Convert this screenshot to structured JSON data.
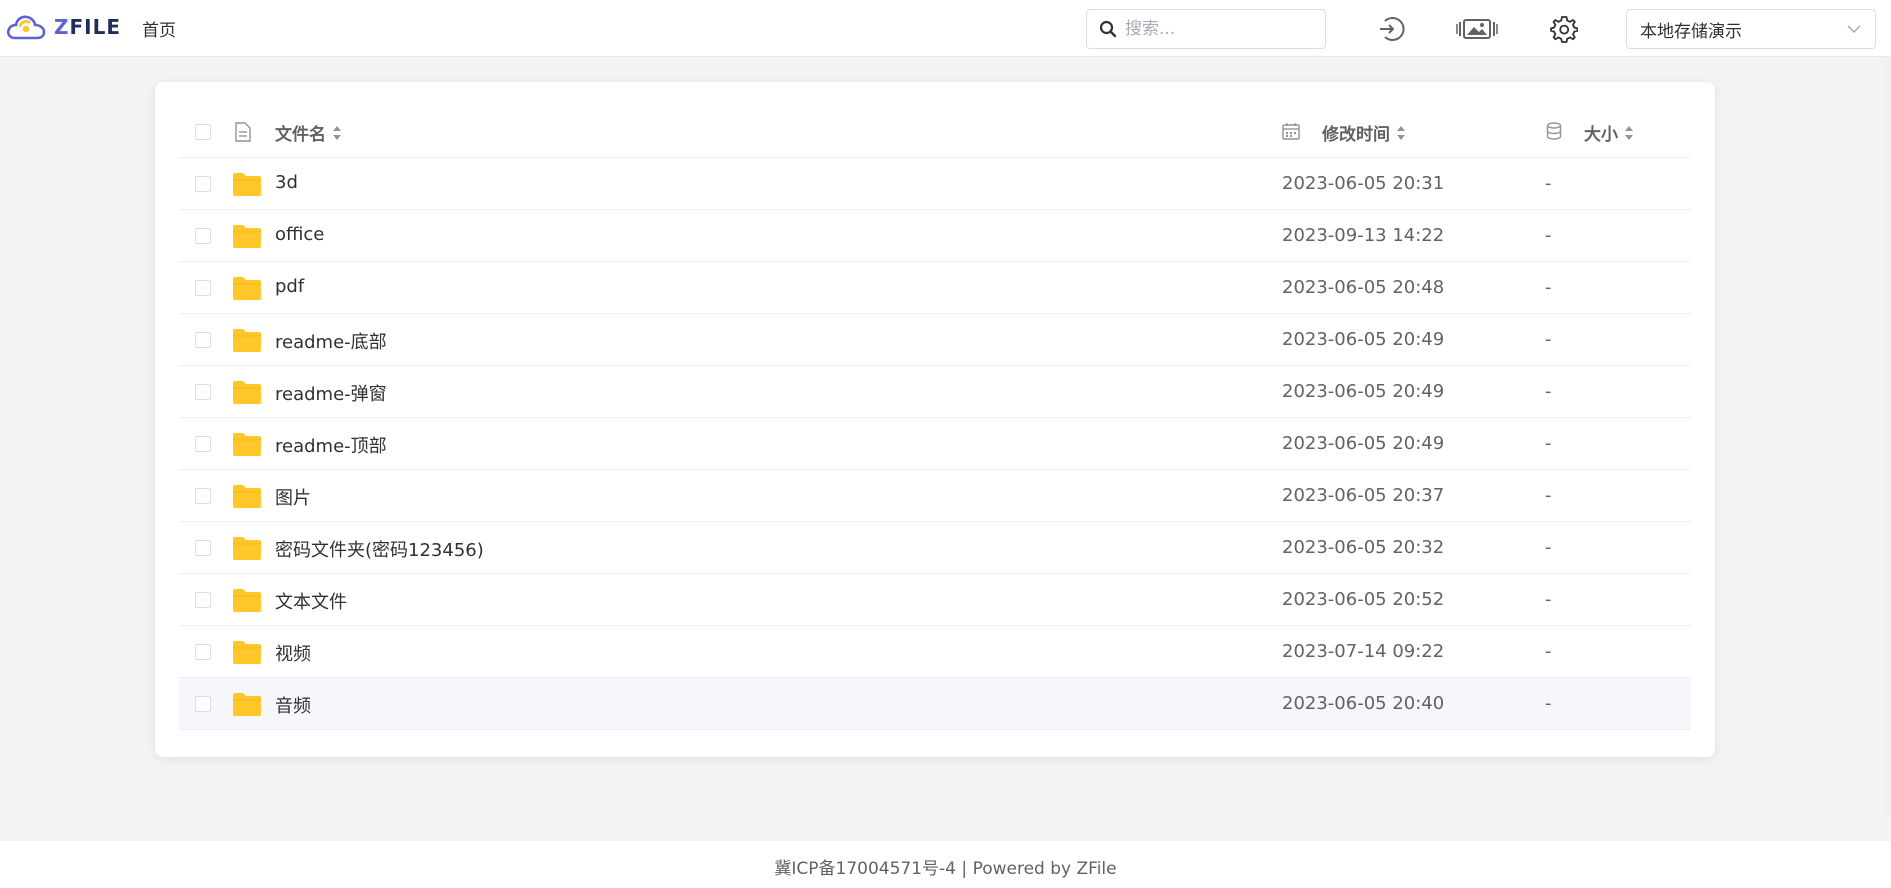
{
  "header": {
    "logo_text": "ZFILE",
    "nav_home": "首页",
    "search_placeholder": "搜索...",
    "storage_select": "本地存储演示",
    "icons": [
      "login-icon",
      "gallery-icon",
      "gear-icon"
    ]
  },
  "table": {
    "columns": {
      "name": "文件名",
      "time": "修改时间",
      "size": "大小"
    },
    "rows": [
      {
        "name": "3d",
        "time": "2023-06-05 20:31",
        "size": "-"
      },
      {
        "name": "office",
        "time": "2023-09-13 14:22",
        "size": "-"
      },
      {
        "name": "pdf",
        "time": "2023-06-05 20:48",
        "size": "-"
      },
      {
        "name": "readme-底部",
        "time": "2023-06-05 20:49",
        "size": "-"
      },
      {
        "name": "readme-弹窗",
        "time": "2023-06-05 20:49",
        "size": "-"
      },
      {
        "name": "readme-顶部",
        "time": "2023-06-05 20:49",
        "size": "-"
      },
      {
        "name": "图片",
        "time": "2023-06-05 20:37",
        "size": "-"
      },
      {
        "name": "密码文件夹(密码123456)",
        "time": "2023-06-05 20:32",
        "size": "-"
      },
      {
        "name": "文本文件",
        "time": "2023-06-05 20:52",
        "size": "-"
      },
      {
        "name": "视频",
        "time": "2023-07-14 09:22",
        "size": "-"
      },
      {
        "name": "音频",
        "time": "2023-06-05 20:40",
        "size": "-"
      }
    ]
  },
  "footer": {
    "icp": "冀ICP备17004571号-4",
    "separator": " | ",
    "powered": "Powered by ",
    "brand": "ZFile"
  },
  "colors": {
    "folder": "#ffc72a",
    "brand": "#5b63d3"
  }
}
